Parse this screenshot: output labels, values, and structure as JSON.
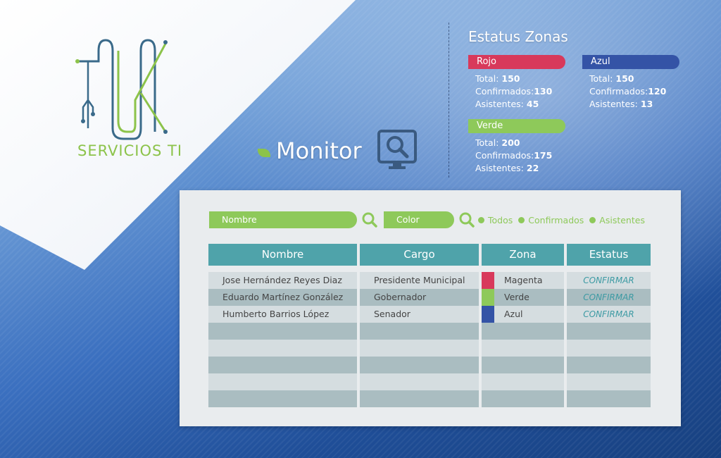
{
  "brand": {
    "logo_text": "SERVICIOS TI",
    "accent": "#8cc34a"
  },
  "monitor": {
    "label": "Monitor"
  },
  "status": {
    "title": "Estatus Zonas",
    "zones": [
      {
        "name": "Rojo",
        "color": "#d8395b",
        "total_label": "Total:",
        "total": "150",
        "confirmed_label": "Confirmados:",
        "confirmed": "130",
        "attendees_label": "Asistentes:",
        "attendees": "45"
      },
      {
        "name": "Azul",
        "color": "#3453a6",
        "total_label": "Total:",
        "total": "150",
        "confirmed_label": "Confirmados:",
        "confirmed": "120",
        "attendees_label": "Asistentes:",
        "attendees": "13"
      },
      {
        "name": "Verde",
        "color": "#8ec95a",
        "total_label": "Total:",
        "total": "200",
        "confirmed_label": "Confirmados:",
        "confirmed": "175",
        "attendees_label": "Asistentes:",
        "attendees": "22"
      }
    ]
  },
  "filters": {
    "name_placeholder": "Nombre",
    "color_placeholder": "Color",
    "options": [
      "Todos",
      "Confirmados",
      "Asistentes"
    ]
  },
  "table": {
    "headers": [
      "Nombre",
      "Cargo",
      "Zona",
      "Estatus"
    ],
    "rows": [
      {
        "name": "Jose Hernández Reyes Diaz",
        "position": "Presidente Municipal",
        "zone": "Magenta",
        "zone_color": "#d8395b",
        "status": "CONFIRMAR"
      },
      {
        "name": "Eduardo Martínez González",
        "position": "Gobernador",
        "zone": "Verde",
        "zone_color": "#8ec95a",
        "status": "CONFIRMAR"
      },
      {
        "name": "Humberto Barrios López",
        "position": "Senador",
        "zone": "Azul",
        "zone_color": "#3453a6",
        "status": "CONFIRMAR"
      }
    ],
    "empty_rows": 5
  }
}
